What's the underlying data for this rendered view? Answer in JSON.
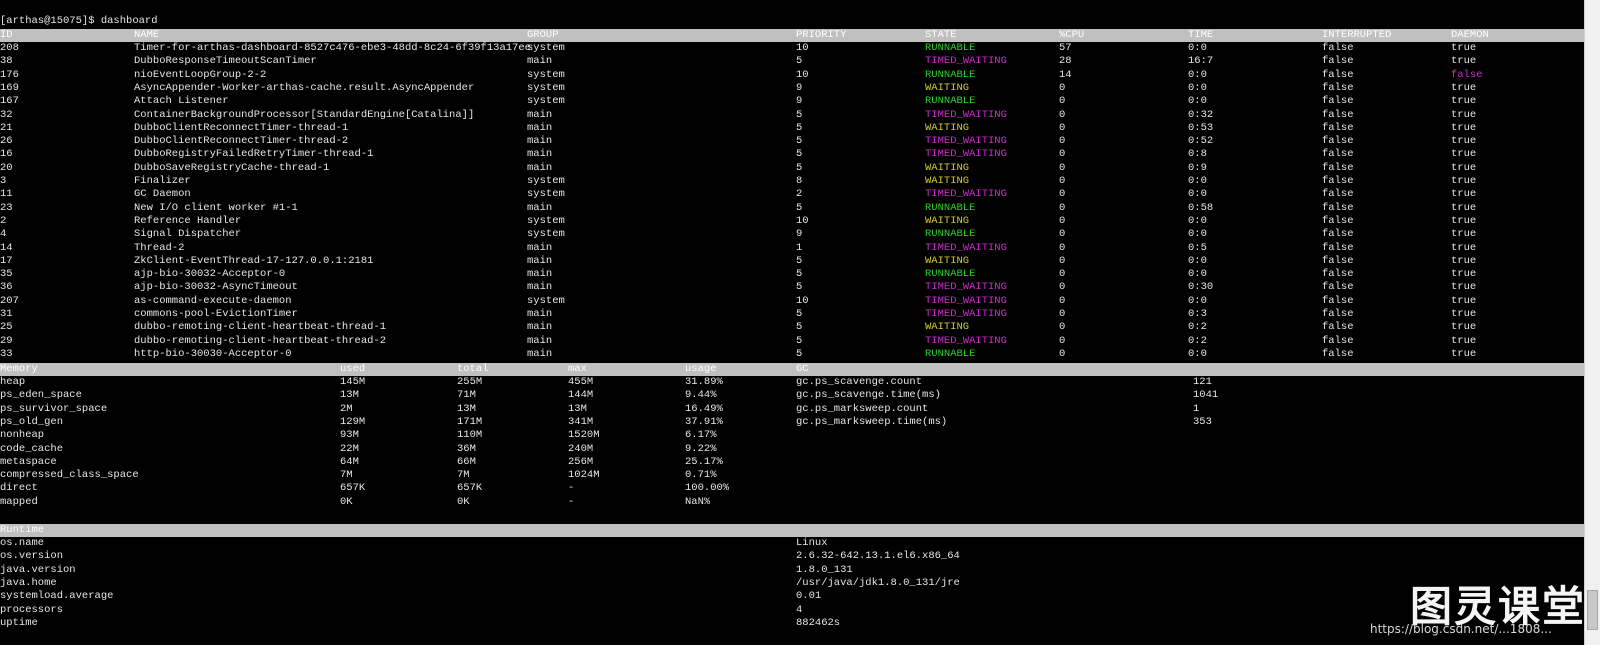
{
  "prompt": "[arthas@15075]$ dashboard",
  "threads": {
    "headers": [
      "ID",
      "NAME",
      "GROUP",
      "PRIORITY",
      "STATE",
      "%CPU",
      "TIME",
      "INTERRUPTED",
      "DAEMON"
    ],
    "rows": [
      [
        "208",
        "Timer-for-arthas-dashboard-8527c476-ebe3-48dd-8c24-6f39f13a17ee",
        "system",
        "10",
        "RUNNABLE",
        "57",
        "0:0",
        "false",
        "true"
      ],
      [
        "38",
        "DubboResponseTimeoutScanTimer",
        "main",
        "5",
        "TIMED_WAITING",
        "28",
        "16:7",
        "false",
        "true"
      ],
      [
        "176",
        "nioEventLoopGroup-2-2",
        "system",
        "10",
        "RUNNABLE",
        "14",
        "0:0",
        "false",
        "false"
      ],
      [
        "169",
        "AsyncAppender-Worker-arthas-cache.result.AsyncAppender",
        "system",
        "9",
        "WAITING",
        "0",
        "0:0",
        "false",
        "true"
      ],
      [
        "167",
        "Attach Listener",
        "system",
        "9",
        "RUNNABLE",
        "0",
        "0:0",
        "false",
        "true"
      ],
      [
        "32",
        "ContainerBackgroundProcessor[StandardEngine[Catalina]]",
        "main",
        "5",
        "TIMED_WAITING",
        "0",
        "0:32",
        "false",
        "true"
      ],
      [
        "21",
        "DubboClientReconnectTimer-thread-1",
        "main",
        "5",
        "WAITING",
        "0",
        "0:53",
        "false",
        "true"
      ],
      [
        "26",
        "DubboClientReconnectTimer-thread-2",
        "main",
        "5",
        "TIMED_WAITING",
        "0",
        "0:52",
        "false",
        "true"
      ],
      [
        "16",
        "DubboRegistryFailedRetryTimer-thread-1",
        "main",
        "5",
        "TIMED_WAITING",
        "0",
        "0:8",
        "false",
        "true"
      ],
      [
        "20",
        "DubboSaveRegistryCache-thread-1",
        "main",
        "5",
        "WAITING",
        "0",
        "0:9",
        "false",
        "true"
      ],
      [
        "3",
        "Finalizer",
        "system",
        "8",
        "WAITING",
        "0",
        "0:0",
        "false",
        "true"
      ],
      [
        "11",
        "GC Daemon",
        "system",
        "2",
        "TIMED_WAITING",
        "0",
        "0:0",
        "false",
        "true"
      ],
      [
        "23",
        "New I/O client worker #1-1",
        "main",
        "5",
        "RUNNABLE",
        "0",
        "0:58",
        "false",
        "true"
      ],
      [
        "2",
        "Reference Handler",
        "system",
        "10",
        "WAITING",
        "0",
        "0:0",
        "false",
        "true"
      ],
      [
        "4",
        "Signal Dispatcher",
        "system",
        "9",
        "RUNNABLE",
        "0",
        "0:0",
        "false",
        "true"
      ],
      [
        "14",
        "Thread-2",
        "main",
        "1",
        "TIMED_WAITING",
        "0",
        "0:5",
        "false",
        "true"
      ],
      [
        "17",
        "ZkClient-EventThread-17-127.0.0.1:2181",
        "main",
        "5",
        "WAITING",
        "0",
        "0:0",
        "false",
        "true"
      ],
      [
        "35",
        "ajp-bio-30032-Acceptor-0",
        "main",
        "5",
        "RUNNABLE",
        "0",
        "0:0",
        "false",
        "true"
      ],
      [
        "36",
        "ajp-bio-30032-AsyncTimeout",
        "main",
        "5",
        "TIMED_WAITING",
        "0",
        "0:30",
        "false",
        "true"
      ],
      [
        "207",
        "as-command-execute-daemon",
        "system",
        "10",
        "TIMED_WAITING",
        "0",
        "0:0",
        "false",
        "true"
      ],
      [
        "31",
        "commons-pool-EvictionTimer",
        "main",
        "5",
        "TIMED_WAITING",
        "0",
        "0:3",
        "false",
        "true"
      ],
      [
        "25",
        "dubbo-remoting-client-heartbeat-thread-1",
        "main",
        "5",
        "WAITING",
        "0",
        "0:2",
        "false",
        "true"
      ],
      [
        "29",
        "dubbo-remoting-client-heartbeat-thread-2",
        "main",
        "5",
        "TIMED_WAITING",
        "0",
        "0:2",
        "false",
        "true"
      ],
      [
        "33",
        "http-bio-30030-Acceptor-0",
        "main",
        "5",
        "RUNNABLE",
        "0",
        "0:0",
        "false",
        "true"
      ]
    ]
  },
  "memory": {
    "headers": [
      "Memory",
      "used",
      "total",
      "max",
      "usage",
      "GC"
    ],
    "rows": [
      [
        "heap",
        "145M",
        "255M",
        "455M",
        "31.89%"
      ],
      [
        "ps_eden_space",
        "13M",
        "71M",
        "144M",
        "9.44%"
      ],
      [
        "ps_survivor_space",
        "2M",
        "13M",
        "13M",
        "16.49%"
      ],
      [
        "ps_old_gen",
        "129M",
        "171M",
        "341M",
        "37.91%"
      ],
      [
        "nonheap",
        "93M",
        "110M",
        "1520M",
        "6.17%"
      ],
      [
        "code_cache",
        "22M",
        "36M",
        "240M",
        "9.22%"
      ],
      [
        "metaspace",
        "64M",
        "66M",
        "256M",
        "25.17%"
      ],
      [
        "compressed_class_space",
        "7M",
        "7M",
        "1024M",
        "0.71%"
      ],
      [
        "direct",
        "657K",
        "657K",
        "-",
        "100.00%"
      ],
      [
        "mapped",
        "0K",
        "0K",
        "-",
        "NaN%"
      ]
    ],
    "gc": [
      [
        "gc.ps_scavenge.count",
        "121"
      ],
      [
        "gc.ps_scavenge.time(ms)",
        "1041"
      ],
      [
        "gc.ps_marksweep.count",
        "1"
      ],
      [
        "gc.ps_marksweep.time(ms)",
        "353"
      ]
    ]
  },
  "runtime": {
    "header": "Runtime",
    "rows": [
      [
        "os.name",
        "Linux"
      ],
      [
        "os.version",
        "2.6.32-642.13.1.el6.x86_64"
      ],
      [
        "java.version",
        "1.8.0_131"
      ],
      [
        "java.home",
        "/usr/java/jdk1.8.0_131/jre"
      ],
      [
        "systemload.average",
        "0.01"
      ],
      [
        "processors",
        "4"
      ],
      [
        "uptime",
        "882462s"
      ]
    ]
  },
  "watermark": {
    "brand": "图灵课堂",
    "url": "https://blog.csdn.net/...1808..."
  },
  "colors": {
    "runnable": "#2ecc2e",
    "waiting": "#d4cc2a",
    "timed_waiting": "#d12ad1",
    "header_bg": "#c0c0c0"
  }
}
